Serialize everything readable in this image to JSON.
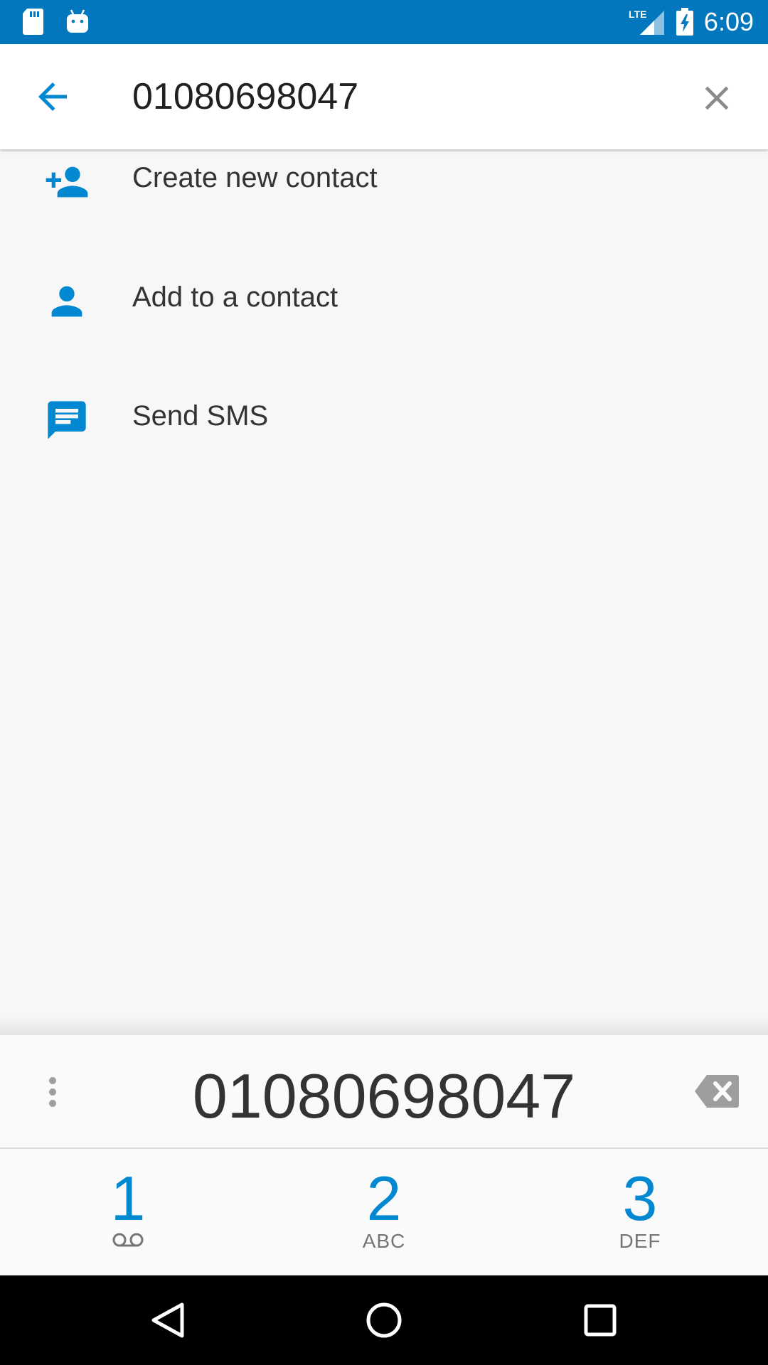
{
  "status_bar": {
    "time": "6:09",
    "network": "LTE",
    "left_icons": [
      "sd-card-icon",
      "android-icon"
    ],
    "right_icons": [
      "signal-icon",
      "battery-charging-icon"
    ],
    "background": "#0277bd"
  },
  "search": {
    "query": "01080698047",
    "back_icon": "arrow-back-icon",
    "clear_icon": "close-icon"
  },
  "actions": [
    {
      "label": "Create new contact",
      "icon": "person-add-icon"
    },
    {
      "label": "Add to a contact",
      "icon": "person-icon"
    },
    {
      "label": "Send SMS",
      "icon": "message-icon"
    }
  ],
  "dialpad": {
    "digits": "01080698047",
    "overflow_icon": "more-vert-icon",
    "backspace_icon": "backspace-icon",
    "keys": [
      {
        "digit": "1",
        "letters": "",
        "sub_icon": "voicemail-icon"
      },
      {
        "digit": "2",
        "letters": "ABC"
      },
      {
        "digit": "3",
        "letters": "DEF"
      }
    ]
  },
  "nav_bar": {
    "buttons": [
      "back-triangle-icon",
      "home-circle-icon",
      "recents-square-icon"
    ]
  },
  "colors": {
    "accent": "#0288d1",
    "status_bar": "#0277bd",
    "text_primary": "#333333",
    "text_secondary": "#757575"
  }
}
